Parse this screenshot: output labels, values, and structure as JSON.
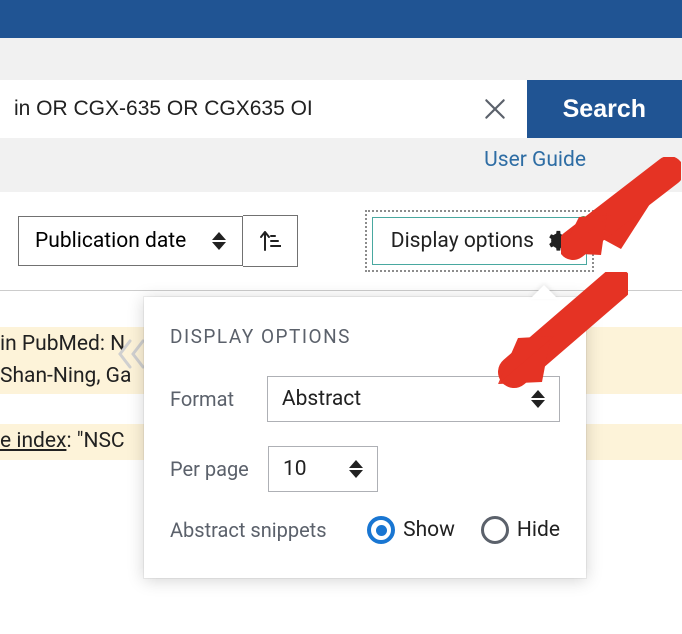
{
  "search": {
    "input_value": "in OR CGX-635 OR CGX635 OI",
    "button_label": "Search",
    "user_guide_label": "User Guide"
  },
  "toolbar": {
    "sort_label": "Publication date",
    "display_options_label": "Display options"
  },
  "popover": {
    "title": "DISPLAY OPTIONS",
    "format_label": "Format",
    "format_value": "Abstract",
    "per_page_label": "Per page",
    "per_page_value": "10",
    "snippets_label": "Abstract snippets",
    "show_label": "Show",
    "hide_label": "Hide"
  },
  "results": {
    "line1a": " in PubMed: N",
    "line1b": "Shan-Ning, Ga",
    "line2a": "e index",
    "line2b": ": \"NSC "
  }
}
